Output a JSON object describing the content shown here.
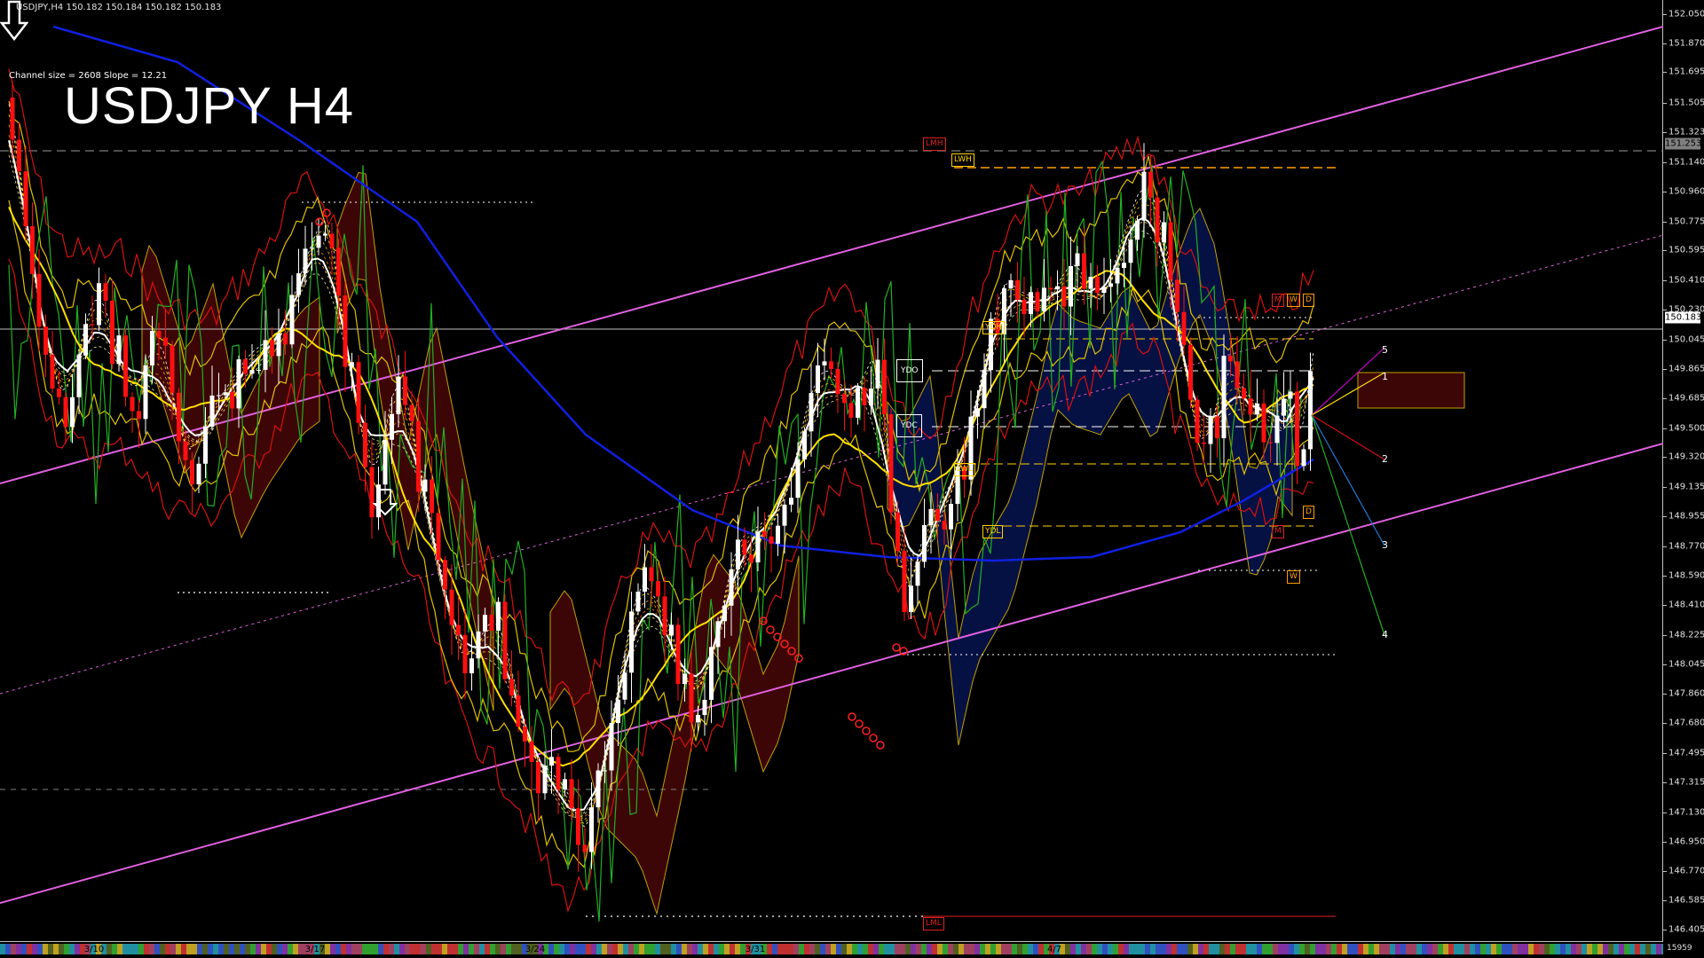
{
  "window": {
    "header": "USDJPY,H4  150.182 150.184 150.182 150.183",
    "channel_info": "Channel size = 2608 Slope = 12.21",
    "title": "USDJPY H4",
    "corner_label": "15959"
  },
  "price_axis": {
    "labels": [
      "152.050",
      "151.870",
      "151.695",
      "151.505",
      "151.323",
      "151.140",
      "150.960",
      "150.775",
      "150.595",
      "150.410",
      "150.230",
      "150.045",
      "149.865",
      "149.685",
      "149.500",
      "149.320",
      "149.135",
      "148.955",
      "148.770",
      "148.590",
      "148.410",
      "148.225",
      "148.045",
      "147.860",
      "147.680",
      "147.495",
      "147.315",
      "147.130",
      "146.950",
      "146.770",
      "146.585",
      "146.405"
    ],
    "price_box_current": "150.183",
    "price_box_top": "151.253",
    "min": 146.33,
    "max": 152.14
  },
  "time_axis": {
    "labels": [
      "3/10",
      "3/17",
      "3/24",
      "3/31",
      "4/7"
    ]
  },
  "levels": {
    "lmh": "LMH",
    "lwh": "LWH",
    "lml": "LML",
    "ydh": "YDH",
    "ydl": "YDL",
    "lwl": "LWL",
    "ydo": "YDO",
    "ydc": "YDC",
    "w_top": "W",
    "ww_top": "W",
    "d_top": "D",
    "d_bottom": "D",
    "m_top": "M",
    "m_bottom": "M",
    "w_bottom": "W"
  },
  "projections": [
    "5",
    "1",
    "2",
    "3",
    "4"
  ],
  "colors": {
    "background": "#000000",
    "channel": "#e060e0",
    "bull_candle": "#ffffff",
    "bear_candle": "#ff1010",
    "ma_fast": "#ffffff",
    "ma_mid": "#ffe000",
    "ma_slow": "#1020e0",
    "bollinger": "#d81010",
    "envelope": "#e0c000",
    "oscillator": "#20b020",
    "cloud_bear": "#b01010",
    "cloud_bull": "#1030c0"
  }
}
